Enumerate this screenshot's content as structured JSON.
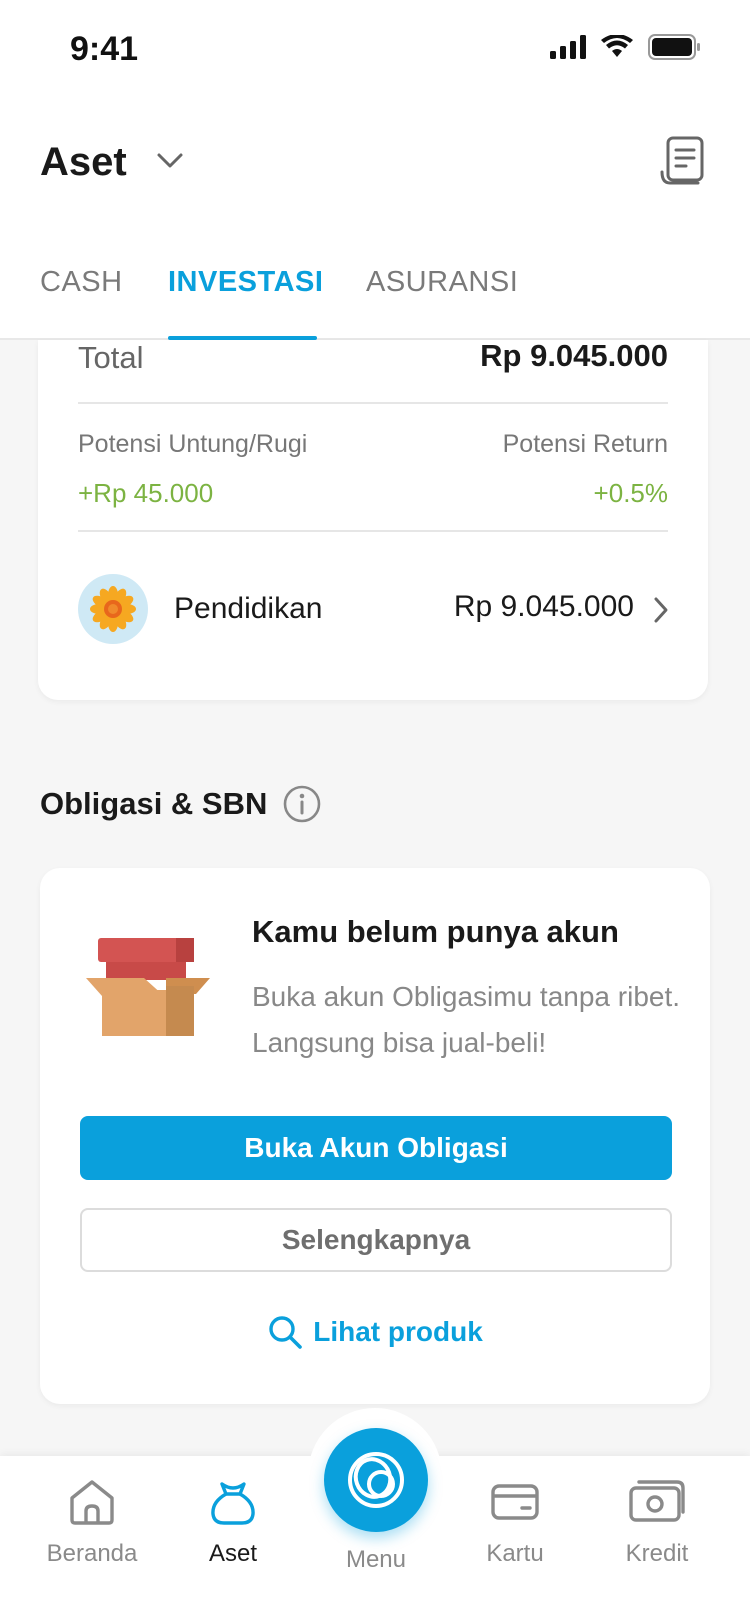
{
  "status_bar": {
    "time": "9:41"
  },
  "header": {
    "title": "Aset"
  },
  "tabs": [
    {
      "label": "CASH",
      "active": false
    },
    {
      "label": "INVESTASI",
      "active": true
    },
    {
      "label": "ASURANSI",
      "active": false
    }
  ],
  "summary": {
    "total_label": "Total",
    "total_value": "Rp 9.045.000",
    "potential_gain_label": "Potensi Untung/Rugi",
    "potential_gain_value": "+Rp 45.000",
    "potential_return_label": "Potensi Return",
    "potential_return_value": "+0.5%",
    "goal": {
      "name": "Pendidikan",
      "value": "Rp 9.045.000",
      "icon": "sunflower-icon"
    }
  },
  "obligasi": {
    "section_title": "Obligasi & SBN",
    "card_title": "Kamu belum punya akun",
    "card_desc": "Buka akun Obligasimu tanpa ribet. Langsung bisa jual-beli!",
    "primary_button": "Buka Akun Obligasi",
    "secondary_button": "Selengkapnya",
    "link": "Lihat produk"
  },
  "bottom_nav": {
    "items": [
      {
        "label": "Beranda",
        "icon": "home-icon",
        "active": false
      },
      {
        "label": "Aset",
        "icon": "money-bag-icon",
        "active": true
      },
      {
        "label": "Menu",
        "icon": "menu-logo-icon",
        "active": false
      },
      {
        "label": "Kartu",
        "icon": "card-icon",
        "active": false
      },
      {
        "label": "Kredit",
        "icon": "cash-icon",
        "active": false
      }
    ]
  },
  "colors": {
    "accent": "#0aa0dc",
    "positive": "#7cb342",
    "text_primary": "#1a1a1a",
    "text_secondary": "#888888"
  }
}
